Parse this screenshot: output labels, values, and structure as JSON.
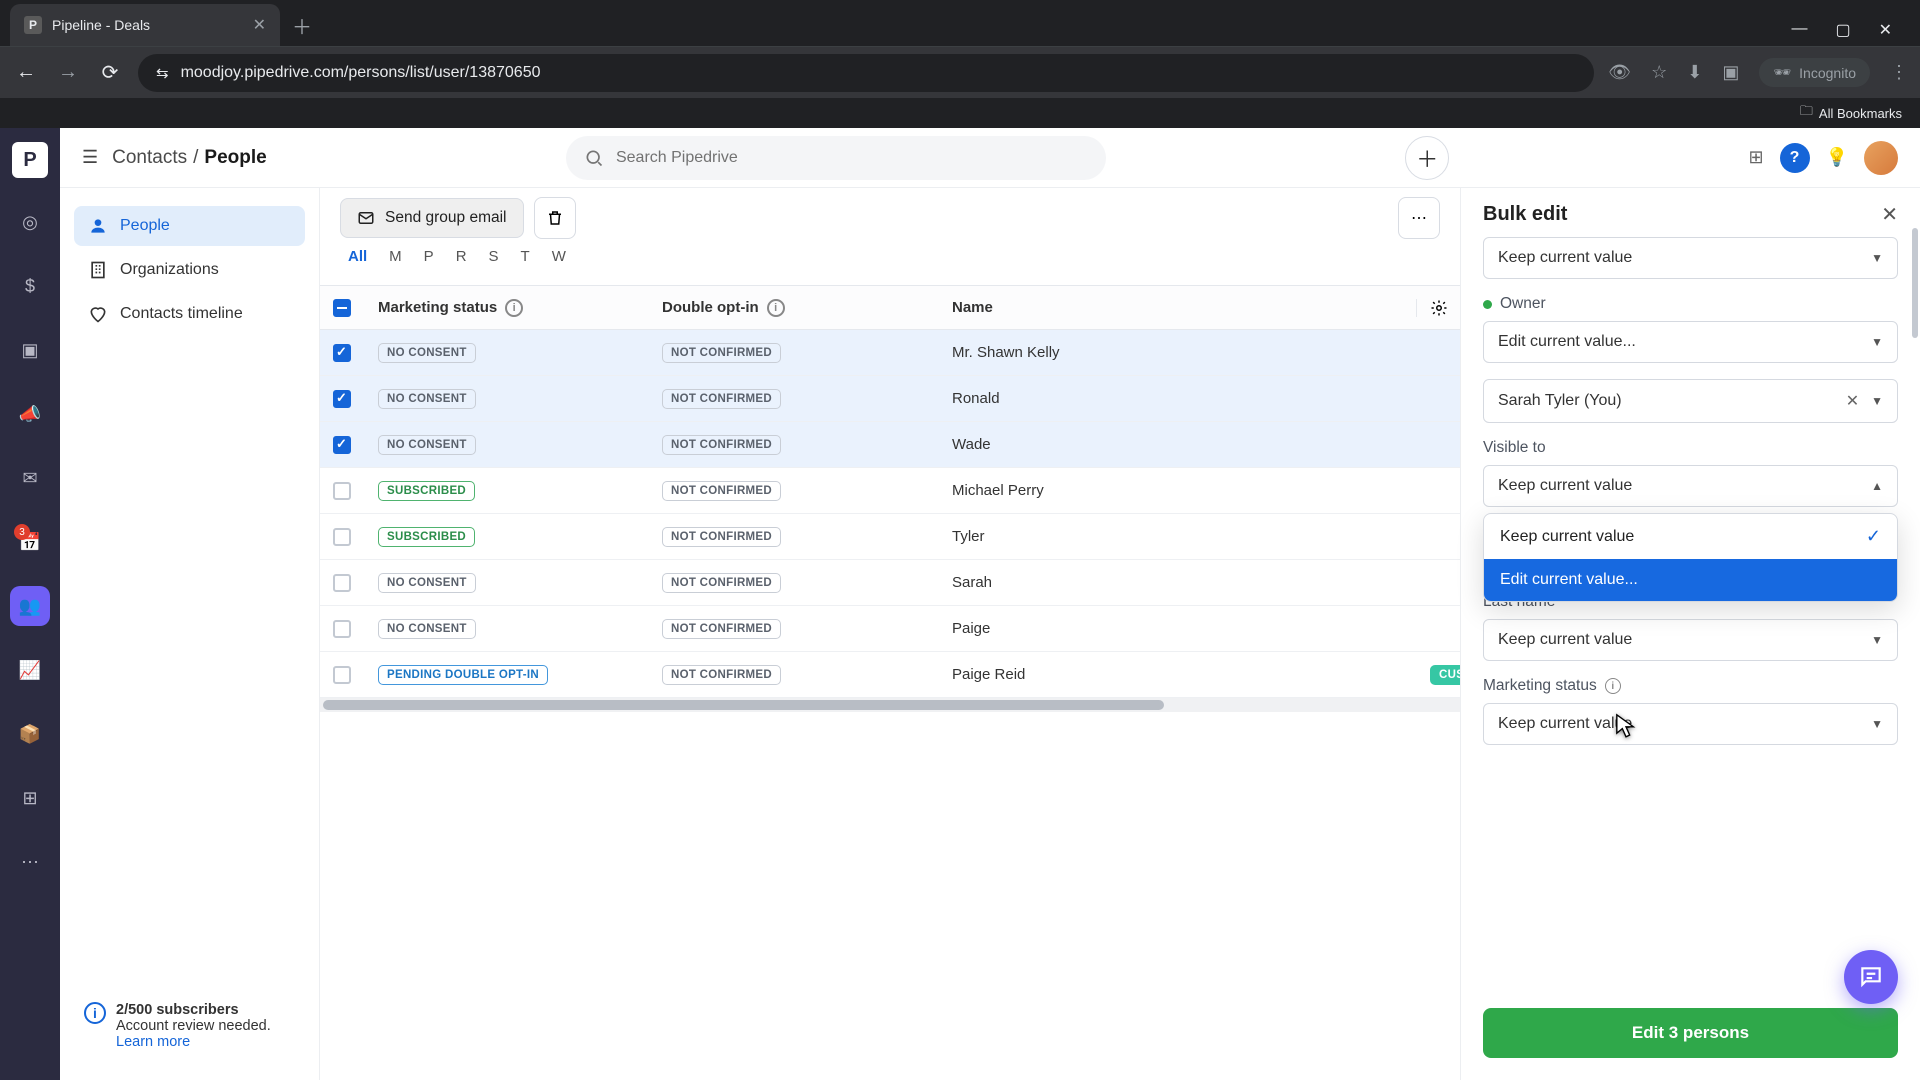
{
  "browser": {
    "tab_title": "Pipeline - Deals",
    "url": "moodjoy.pipedrive.com/persons/list/user/13870650",
    "incognito_label": "Incognito",
    "all_bookmarks": "All Bookmarks"
  },
  "rail": {
    "badge": "3"
  },
  "topbar": {
    "crumb_root": "Contacts",
    "crumb_sep": "/",
    "crumb_leaf": "People",
    "search_placeholder": "Search Pipedrive"
  },
  "subnav": {
    "people": "People",
    "orgs": "Organizations",
    "timeline": "Contacts timeline"
  },
  "footer_info": {
    "count": "2/500 subscribers",
    "body": "Account review needed. ",
    "link": "Learn more"
  },
  "actionbar": {
    "send_email": "Send group email"
  },
  "filters": [
    "All",
    "M",
    "P",
    "R",
    "S",
    "T",
    "W"
  ],
  "columns": {
    "marketing_status": "Marketing status",
    "double_optin": "Double opt-in",
    "name": "Name"
  },
  "badges": {
    "no_consent": "NO CONSENT",
    "subscribed": "SUBSCRIBED",
    "not_confirmed": "NOT CONFIRMED",
    "pending": "PENDING DOUBLE OPT-IN",
    "custom": "CUSTO"
  },
  "rows": [
    {
      "selected": true,
      "ms": "no_consent",
      "name": "Mr. Shawn Kelly"
    },
    {
      "selected": true,
      "ms": "no_consent",
      "name": "Ronald"
    },
    {
      "selected": true,
      "ms": "no_consent",
      "name": "Wade"
    },
    {
      "selected": false,
      "ms": "subscribed",
      "name": "Michael Perry"
    },
    {
      "selected": false,
      "ms": "subscribed",
      "name": "Tyler"
    },
    {
      "selected": false,
      "ms": "no_consent",
      "name": "Sarah"
    },
    {
      "selected": false,
      "ms": "no_consent",
      "name": "Paige"
    },
    {
      "selected": false,
      "ms": "pending",
      "name": "Paige Reid",
      "extra": "custom"
    }
  ],
  "panel": {
    "title": "Bulk edit",
    "keep_current": "Keep current value",
    "edit_current": "Edit current value...",
    "owner_label": "Owner",
    "owner_value": "Sarah Tyler (You)",
    "visible_to": "Visible to",
    "last_name": "Last name",
    "marketing_status": "Marketing status",
    "submit": "Edit 3 persons"
  }
}
